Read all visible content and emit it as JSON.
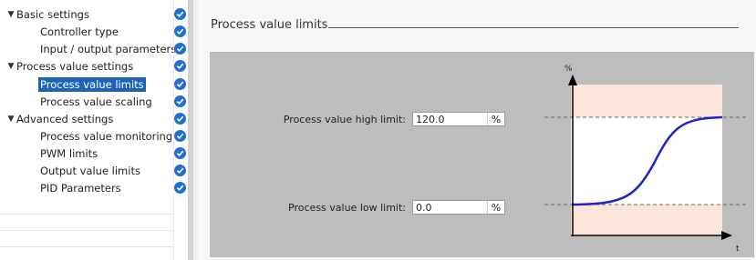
{
  "nav": {
    "items": [
      {
        "label": "Basic settings",
        "level": 0,
        "expanded": true,
        "checked": true,
        "selected": false
      },
      {
        "label": "Controller type",
        "level": 1,
        "checked": true,
        "selected": false
      },
      {
        "label": "Input / output parameters",
        "level": 1,
        "checked": true,
        "selected": false
      },
      {
        "label": "Process value settings",
        "level": 0,
        "expanded": true,
        "checked": true,
        "selected": false
      },
      {
        "label": "Process value limits",
        "level": 1,
        "checked": true,
        "selected": true
      },
      {
        "label": "Process value scaling",
        "level": 1,
        "checked": true,
        "selected": false
      },
      {
        "label": "Advanced settings",
        "level": 0,
        "expanded": true,
        "checked": true,
        "selected": false
      },
      {
        "label": "Process value monitoring",
        "level": 1,
        "checked": true,
        "selected": false
      },
      {
        "label": "PWM limits",
        "level": 1,
        "checked": true,
        "selected": false
      },
      {
        "label": "Output value limits",
        "level": 1,
        "checked": true,
        "selected": false
      },
      {
        "label": "PID Parameters",
        "level": 1,
        "checked": true,
        "selected": false
      }
    ]
  },
  "main": {
    "title": "Process value limits",
    "high_limit": {
      "label": "Process value high limit:",
      "value": "120.0",
      "unit": "%"
    },
    "low_limit": {
      "label": "Process value low limit:",
      "value": "0.0",
      "unit": "%"
    },
    "graph": {
      "y_axis_label": "%",
      "x_axis_label": "t"
    }
  },
  "colors": {
    "accent": "#1f63b8",
    "check": "#1f6ed4",
    "panel": "#bdbdbd",
    "out_of_range_zone": "#fbe5da",
    "curve": "#1e22c8"
  }
}
